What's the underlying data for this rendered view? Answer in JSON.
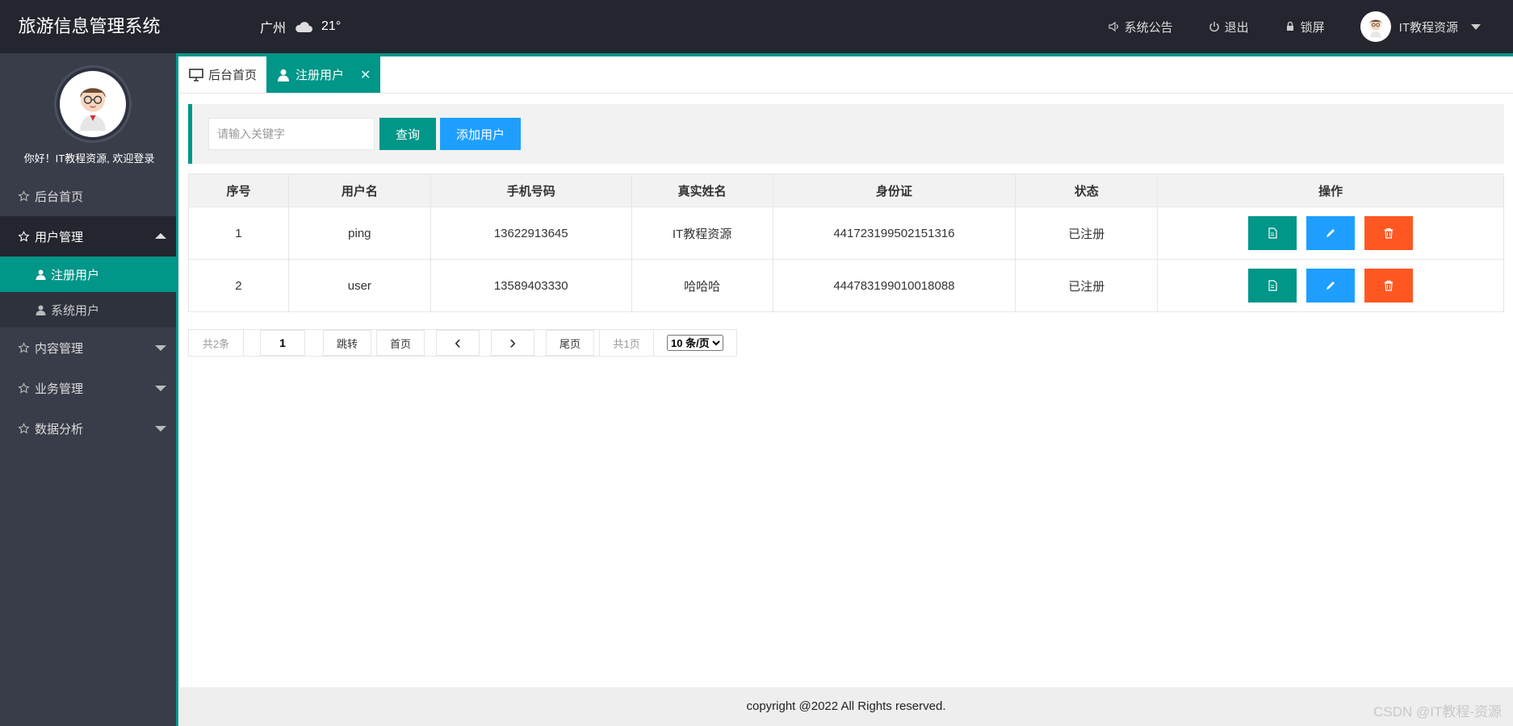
{
  "app": {
    "title": "旅游信息管理系统"
  },
  "weather": {
    "city": "广州",
    "icon": "cloud-icon",
    "temp": "21°"
  },
  "header": {
    "notice": "系统公告",
    "logout": "退出",
    "lock": "锁屏",
    "username": "IT教程资源"
  },
  "sidebar": {
    "welcome": "你好！IT教程资源, 欢迎登录",
    "items": [
      {
        "label": "后台首页"
      },
      {
        "label": "用户管理",
        "expanded": true,
        "children": [
          {
            "label": "注册用户",
            "active": true
          },
          {
            "label": "系统用户"
          }
        ]
      },
      {
        "label": "内容管理"
      },
      {
        "label": "业务管理"
      },
      {
        "label": "数据分析"
      }
    ]
  },
  "tabs": [
    {
      "label": "后台首页",
      "icon": "monitor-icon"
    },
    {
      "label": "注册用户",
      "icon": "user-icon",
      "active": true,
      "close": "✕"
    }
  ],
  "search": {
    "placeholder": "请输入关键字",
    "value": "",
    "query_label": "查询",
    "add_label": "添加用户"
  },
  "table": {
    "columns": [
      "序号",
      "用户名",
      "手机号码",
      "真实姓名",
      "身份证",
      "状态",
      "操作"
    ],
    "rows": [
      [
        "1",
        "ping",
        "13622913645",
        "IT教程资源",
        "441723199502151316",
        "已注册"
      ],
      [
        "2",
        "user",
        "13589403330",
        "哈哈哈",
        "444783199010018088",
        "已注册"
      ]
    ],
    "actions": [
      "view-icon",
      "edit-icon",
      "delete-icon"
    ],
    "colors": {
      "view": "#009688",
      "edit": "#1e9fff",
      "delete": "#ff5722"
    }
  },
  "pagination": {
    "total": "共2条",
    "page_value": "1",
    "jump": "跳转",
    "first": "首页",
    "prev": "‹",
    "next": "›",
    "last": "尾页",
    "pages": "共1页",
    "page_size": "10 条/页"
  },
  "footer": {
    "copyright": "copyright @2022 All Rights reserved."
  },
  "watermark": "CSDN @IT教程-资源",
  "theme": {
    "accent": "#009688",
    "header_bg": "#23262e",
    "sidebar_bg": "#393d49",
    "blue": "#1e9fff",
    "orange": "#ff5722"
  }
}
